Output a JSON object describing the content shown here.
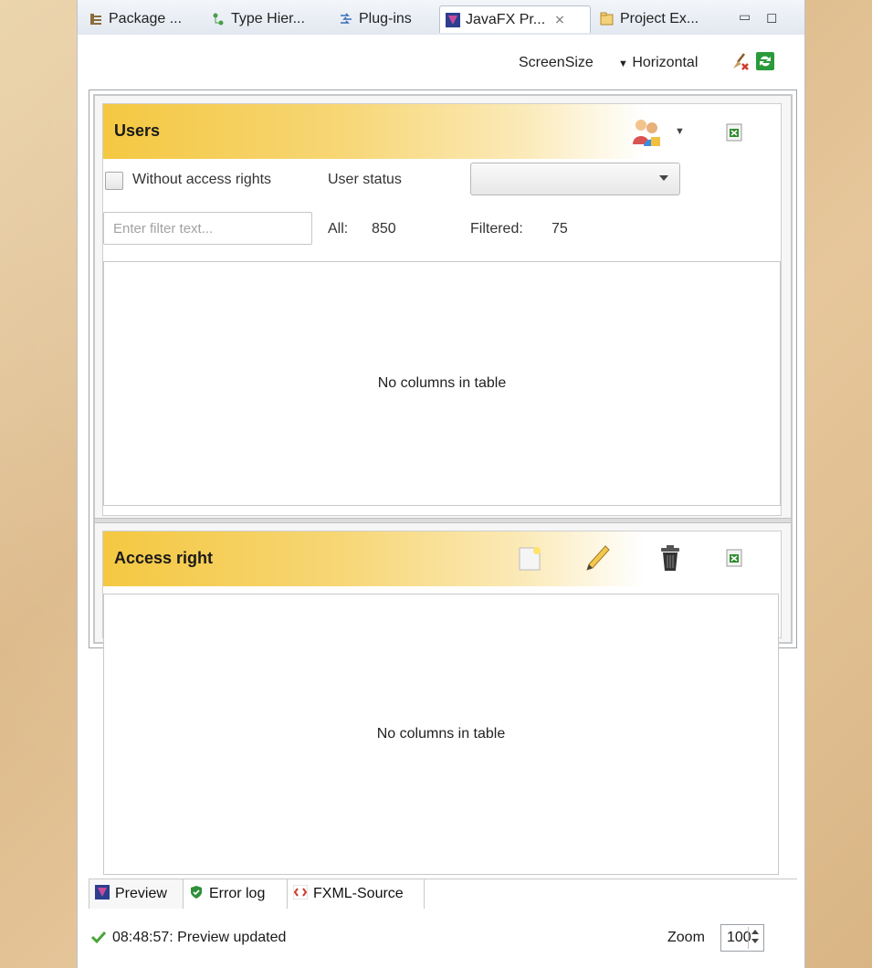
{
  "tabs": [
    {
      "label": "Package ...",
      "icon": "package-explorer-icon"
    },
    {
      "label": "Type Hier...",
      "icon": "type-hierarchy-icon"
    },
    {
      "label": "Plug-ins",
      "icon": "plugins-icon"
    },
    {
      "label": "JavaFX Pr...",
      "icon": "javafx-preview-icon",
      "active": true
    },
    {
      "label": "Project Ex...",
      "icon": "project-explorer-icon"
    }
  ],
  "toolbar": {
    "screensize_label": "ScreenSize",
    "orientation_label": "Horizontal"
  },
  "users": {
    "title": "Users",
    "without_access_label": "Without access rights",
    "user_status_label": "User status",
    "filter_placeholder": "Enter filter text...",
    "all_label": "All:",
    "all_count": "850",
    "filtered_label": "Filtered:",
    "filtered_count": "75",
    "table_empty": "No columns in table"
  },
  "access": {
    "title": "Access right",
    "table_empty": "No columns in table"
  },
  "bottom_tabs": [
    {
      "label": "Preview"
    },
    {
      "label": "Error log"
    },
    {
      "label": "FXML-Source"
    }
  ],
  "status": {
    "message": "08:48:57: Preview updated",
    "zoom_label": "Zoom",
    "zoom_value": "100"
  },
  "colors": {
    "banner_gold": "#f4c841",
    "excel_green": "#2e8b2e"
  }
}
